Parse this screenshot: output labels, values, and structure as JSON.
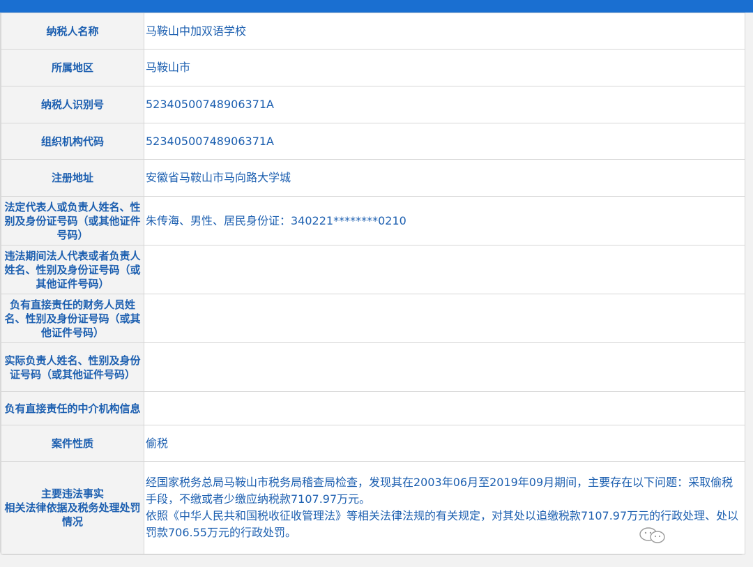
{
  "table": {
    "rows": [
      {
        "label": "纳税人名称",
        "value": "马鞍山中加双语学校"
      },
      {
        "label": "所属地区",
        "value": "马鞍山市"
      },
      {
        "label": "纳税人识别号",
        "value": "52340500748906371A"
      },
      {
        "label": "组织机构代码",
        "value": "52340500748906371A"
      },
      {
        "label": "注册地址",
        "value": "安徽省马鞍山市马向路大学城"
      },
      {
        "label": "法定代表人或负责人姓名、性别及身份证号码（或其他证件号码）",
        "value": "朱传海、男性、居民身份证：340221********0210"
      },
      {
        "label": "违法期间法人代表或者负责人姓名、性别及身份证号码（或其他证件号码）",
        "value": ""
      },
      {
        "label": "负有直接责任的财务人员姓名、性别及身份证号码（或其他证件号码）",
        "value": ""
      },
      {
        "label": "实际负责人姓名、性别及身份证号码（或其他证件号码）",
        "value": ""
      },
      {
        "label": "负有直接责任的中介机构信息",
        "value": ""
      },
      {
        "label": "案件性质",
        "value": "偷税"
      }
    ],
    "facts_row": {
      "label_line1": "主要违法事实",
      "label_line2": "相关法律依据及税务处理处罚情况",
      "paragraph1": "经国家税务总局马鞍山市税务局稽查局检查，发现其在2003年06月至2019年09月期间，主要存在以下问题：采取偷税手段，不缴或者少缴应纳税款7107.97万元。",
      "paragraph2": "依照《中华人民共和国税收征收管理法》等相关法律法规的有关规定，对其处以追缴税款7107.97万元的行政处理、处以罚款706.55万元的行政处罚。"
    }
  },
  "watermark": {
    "icon": "wechat-icon"
  },
  "colors": {
    "accent": "#1a6fd1",
    "text": "#1c5fb0",
    "label_bg": "#f3f3f3"
  }
}
